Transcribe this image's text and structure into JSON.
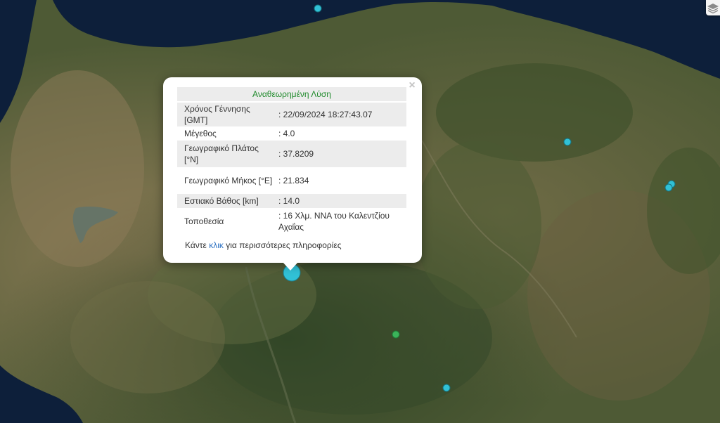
{
  "popup": {
    "title": "Αναθεωρημένη Λύση",
    "close_label": "×",
    "rows": [
      {
        "label": "Χρόνος Γέννησης [GMT]",
        "value": ": 22/09/2024 18:27:43.07"
      },
      {
        "label": "Μέγεθος",
        "value": ": 4.0"
      },
      {
        "label": "Γεωγραφικό Πλάτος [°N]",
        "value": ": 37.8209"
      },
      {
        "label": "Γεωγραφικό Μήκος [°E]",
        "value": ": 21.834"
      },
      {
        "label": "Εστιακό Βάθος [km]",
        "value": ": 14.0"
      },
      {
        "label": "Τοποθεσία",
        "value": ": 16 Χλμ. ΝΝΑ του Καλεντζίου Αχαΐας"
      }
    ],
    "footer": {
      "before": "Κάντε",
      "link": "κλικ",
      "after": "για περισσότερες πληροφορίες"
    }
  },
  "colors": {
    "sea": "#0d1f3a",
    "land": "#4e5a35",
    "marker_cyan": "#31c1d6",
    "marker_green": "#3bb35a",
    "title_green": "#1f8a2b",
    "link_blue": "#2a6fc1"
  },
  "icons": {
    "layers": "layers-icon"
  }
}
